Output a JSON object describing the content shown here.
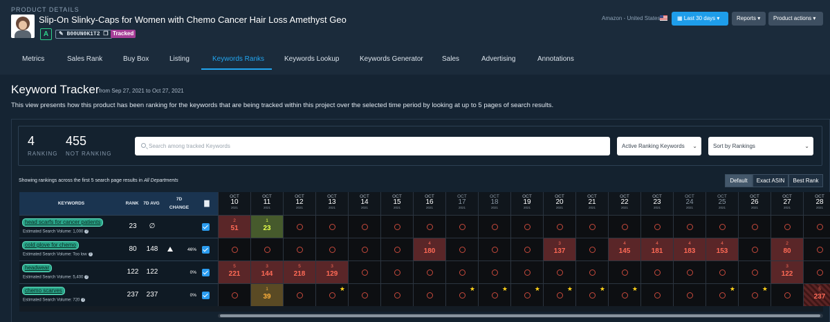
{
  "header": {
    "section_label": "PRODUCT DETAILS",
    "product_title": "Slip-On Slinky-Caps for Women with Chemo Cancer Hair Loss Amethyst Geo",
    "grade": "A",
    "asin": "B00UN0K1T2",
    "tracked_label": "Tracked",
    "marketplace": "Amazon - United States",
    "date_button": "Last 30 days",
    "reports_button": "Reports",
    "actions_button": "Product actions"
  },
  "tabs": [
    "Metrics",
    "Sales Rank",
    "Buy Box",
    "Listing",
    "Keywords Ranks",
    "Keywords Lookup",
    "Keywords Generator",
    "Sales",
    "Advertising",
    "Annotations"
  ],
  "active_tab": "Keywords Ranks",
  "tracker": {
    "title": "Keyword Tracker",
    "range": "from Sep 27, 2021 to Oct 27, 2021",
    "description": "This view presents how this product has been ranking for the keywords that are being tracked within this project over the selected time period by looking at up to 5 pages of search results.",
    "ranking_count": "4",
    "ranking_label": "RANKING",
    "not_ranking_count": "455",
    "not_ranking_label": "NOT RANKING",
    "search_placeholder": "Search among tracked Keywords",
    "filter_select": "Active Ranking Keywords",
    "sort_select": "Sort by Rankings",
    "showing_text": "Showing rankings across the first 5 search page results in",
    "showing_dept": "All Departments",
    "view_buttons": [
      "Default",
      "Exact ASIN",
      "Best Rank"
    ]
  },
  "table": {
    "headers": {
      "keywords": "KEYWORDS",
      "rank": "RANK",
      "avg": "7D AVG",
      "change": "7D CHANGE"
    },
    "chart_icon": "bar-chart-icon",
    "dates": [
      {
        "m": "OCT",
        "d": "10",
        "y": "2021"
      },
      {
        "m": "OCT",
        "d": "11",
        "y": "2021"
      },
      {
        "m": "OCT",
        "d": "12",
        "y": "2021"
      },
      {
        "m": "OCT",
        "d": "13",
        "y": "2021"
      },
      {
        "m": "OCT",
        "d": "14",
        "y": "2021"
      },
      {
        "m": "OCT",
        "d": "15",
        "y": "2021"
      },
      {
        "m": "OCT",
        "d": "16",
        "y": "2021"
      },
      {
        "m": "OCT",
        "d": "17",
        "y": "2021"
      },
      {
        "m": "OCT",
        "d": "18",
        "y": "2021"
      },
      {
        "m": "OCT",
        "d": "19",
        "y": "2021"
      },
      {
        "m": "OCT",
        "d": "20",
        "y": "2021"
      },
      {
        "m": "OCT",
        "d": "21",
        "y": "2021"
      },
      {
        "m": "OCT",
        "d": "22",
        "y": "2021"
      },
      {
        "m": "OCT",
        "d": "23",
        "y": "2021"
      },
      {
        "m": "OCT",
        "d": "24",
        "y": "2021"
      },
      {
        "m": "OCT",
        "d": "25",
        "y": "2021"
      },
      {
        "m": "OCT",
        "d": "26",
        "y": "2021"
      },
      {
        "m": "OCT",
        "d": "27",
        "y": "2021"
      },
      {
        "m": "OCT",
        "d": "28",
        "y": "2021"
      }
    ],
    "dim_dates": [
      7,
      8,
      14,
      15
    ],
    "rows": [
      {
        "keyword": "head scarfs for cancer patients",
        "volume": "Estimated Search Volume: 1,000",
        "rank": "23",
        "avg": "∅",
        "change": "",
        "up": false,
        "cells": [
          {
            "t": "red",
            "p": "2",
            "v": "51"
          },
          {
            "t": "grn",
            "p": "1",
            "v": "23"
          },
          {},
          {},
          {},
          {},
          {},
          {},
          {},
          {},
          {},
          {},
          {},
          {},
          {},
          {},
          {},
          {},
          {}
        ]
      },
      {
        "keyword": "cold glove for chemo",
        "volume": "Estimated Search Volume: Too low",
        "rank": "80",
        "avg": "148",
        "change": "46%",
        "up": true,
        "cells": [
          {},
          {},
          {},
          {},
          {},
          {},
          {
            "t": "red",
            "p": "4",
            "v": "180"
          },
          {},
          {},
          {},
          {
            "t": "red",
            "p": "3",
            "v": "137"
          },
          {},
          {
            "t": "red",
            "p": "4",
            "v": "145"
          },
          {
            "t": "red",
            "p": "4",
            "v": "181"
          },
          {
            "t": "red",
            "p": "4",
            "v": "183"
          },
          {
            "t": "red",
            "p": "4",
            "v": "153"
          },
          {},
          {
            "t": "red",
            "p": "2",
            "v": "80"
          },
          {}
        ]
      },
      {
        "keyword": "headwear",
        "volume": "Estimated Search Volume: 5,400",
        "rank": "122",
        "avg": "122",
        "change": "0%",
        "up": false,
        "cells": [
          {
            "t": "red",
            "p": "5",
            "v": "221"
          },
          {
            "t": "red",
            "p": "3",
            "v": "144"
          },
          {
            "t": "red",
            "p": "5",
            "v": "218"
          },
          {
            "t": "red",
            "p": "3",
            "v": "129"
          },
          {},
          {},
          {},
          {},
          {},
          {},
          {},
          {},
          {},
          {},
          {},
          {},
          {},
          {
            "t": "red",
            "p": "3",
            "v": "122"
          },
          {}
        ]
      },
      {
        "keyword": "chemo scarves",
        "volume": "Estimated Search Volume: 720",
        "rank": "237",
        "avg": "237",
        "change": "0%",
        "up": false,
        "cells": [
          {},
          {
            "t": "org",
            "p": "1",
            "v": "39"
          },
          {},
          {
            "s": true
          },
          {},
          {},
          {},
          {
            "s": true
          },
          {
            "s": true
          },
          {
            "s": true
          },
          {
            "s": true
          },
          {
            "s": true
          },
          {
            "s": true
          },
          {},
          {},
          {
            "s": true
          },
          {
            "s": true
          },
          {},
          {
            "t": "hatch",
            "p": "5",
            "v": "237"
          }
        ]
      }
    ]
  }
}
